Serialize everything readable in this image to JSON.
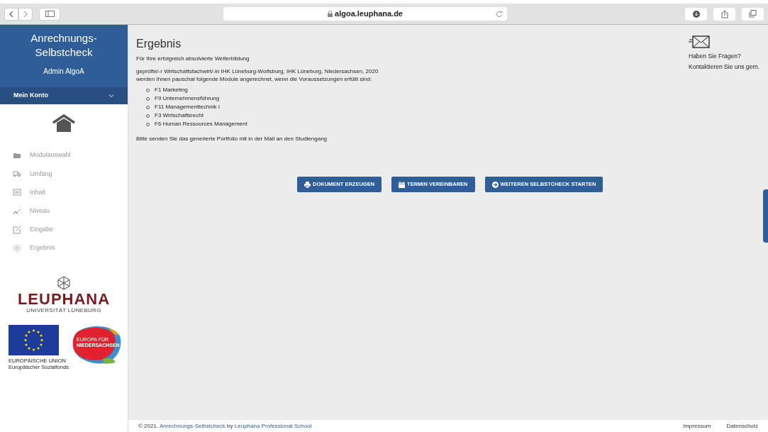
{
  "browser": {
    "url": "algoa.leuphana.de"
  },
  "sidebar": {
    "title": "Anrechnungs-Selbstcheck",
    "user": "Admin AlgoA",
    "account_menu": {
      "label": "Mein Konto",
      "expanded": false
    },
    "items": [
      {
        "label": "Modulauswahl"
      },
      {
        "label": "Umfang"
      },
      {
        "label": "Inhalt"
      },
      {
        "label": "Niveau"
      },
      {
        "label": "Eingabe"
      },
      {
        "label": "Ergebnis"
      }
    ],
    "university_logo": {
      "name": "LEUPHANA",
      "subtitle": "UNIVERSITÄT LÜNEBURG"
    },
    "eu_logo": {
      "line_1": "EUROPÄISCHE UNION",
      "line_2": "Europäischer Sozialfonds"
    },
    "nds_logo": {
      "line_1": "EUROPA FÜR",
      "line_2": "NIEDERSACHSEN"
    }
  },
  "main": {
    "heading": "Ergebnis",
    "intro": "Für Ihre erfolgreich absolvierte Weiterbildung",
    "qualification": "geprüfte/-r Wirtschaftsfachwirt/-in IHK Lüneburg-Wolfsburg, IHK Lüneburg, Niedersachsen, 2020",
    "statement": "werden Ihnen pauschal folgende Module angerechnet, wenn die Voraussetzungen erfüllt sind:",
    "modules": [
      "F1 Marketing",
      "F9 Unternehmensführung",
      "F11 Managementtechnik I",
      "F3 Wirtschaftsrecht",
      "F6 Human Ressources Management"
    ],
    "note": "Bitte senden Sie das generierte Portfolio mit in der Mail an den Studiengang",
    "buttons": [
      {
        "label": "DOKUMENT ERZEUGEN",
        "kind": "print"
      },
      {
        "label": "TERMIN VEREINBAREN",
        "kind": "calendar"
      },
      {
        "label": "WEITEREN SELBSTCHECK STARTEN",
        "kind": "start"
      }
    ]
  },
  "contact": {
    "line_1": "Haben Sie Fragen?",
    "line_2": "Kontaktieren Sie uns gern."
  },
  "footer": {
    "parts": [
      {
        "kind": "text",
        "text": "© 2021. "
      },
      {
        "kind": "link",
        "text": "Anrechnungs-Selbstcheck"
      },
      {
        "kind": "text",
        "text": " by "
      },
      {
        "kind": "link",
        "text": "Leuphana Professional School"
      }
    ],
    "links": [
      "Impressum",
      "Datenschutz"
    ]
  }
}
